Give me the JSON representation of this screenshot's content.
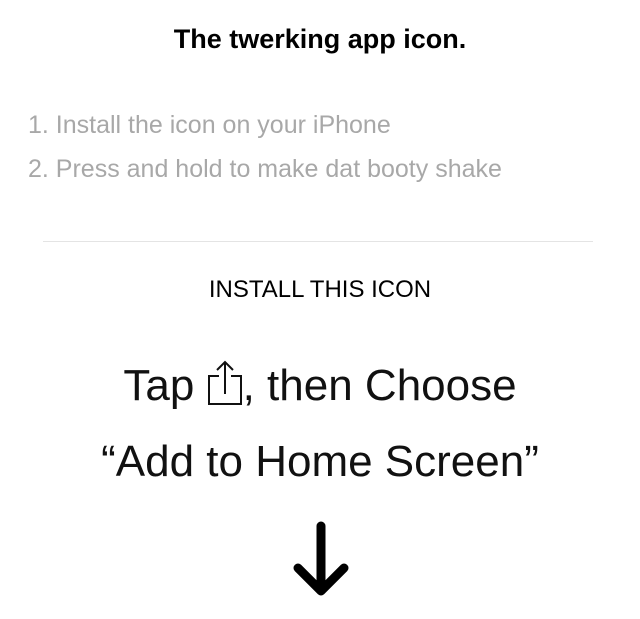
{
  "title": "The twerking app icon.",
  "steps": [
    "1. Install the icon on your iPhone",
    "2. Press and hold to make dat booty shake"
  ],
  "install_heading": "INSTALL THIS ICON",
  "instruction": {
    "tap": "Tap",
    "then_choose": ", then Choose",
    "action": "“Add to Home Screen”"
  },
  "icons": {
    "share": "share-icon",
    "arrow": "arrow-down-icon"
  },
  "colors": {
    "text": "#000000",
    "muted": "#a8a8a8",
    "divider": "#e4e4e4"
  }
}
